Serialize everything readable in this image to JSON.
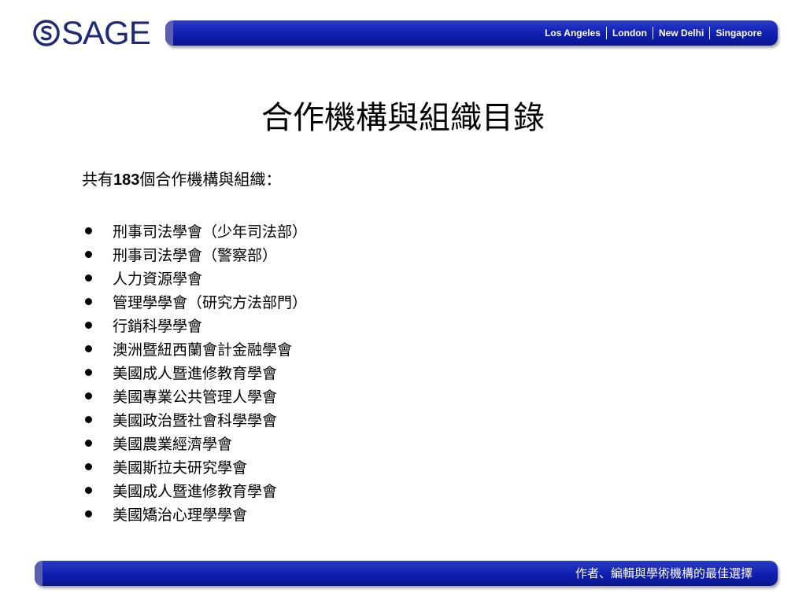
{
  "header": {
    "logo_text": "SAGE",
    "cities": [
      "Los Angeles",
      "London",
      "New Delhi",
      "Singapore"
    ],
    "bar_color": "#1a25b5",
    "logo_color": "#1e2a78"
  },
  "slide": {
    "title": "合作機構與組織目錄",
    "subtitle_prefix": "共有",
    "subtitle_count": "183",
    "subtitle_suffix": "個合作機構與組織：",
    "items": [
      "刑事司法學會（少年司法部）",
      "刑事司法學會（警察部）",
      "人力資源學會",
      "管理學學會（研究方法部門）",
      "行銷科學學會",
      "澳洲暨紐西蘭會計金融學會",
      "美國成人暨進修教育學會",
      "美國專業公共管理人學會",
      "美國政治暨社會科學學會",
      "美國農業經濟學會",
      "美國斯拉夫研究學會",
      "美國成人暨進修教育學會",
      "美國矯治心理學學會"
    ]
  },
  "footer": {
    "tagline": "作者、編輯與學術機構的最佳選擇"
  }
}
